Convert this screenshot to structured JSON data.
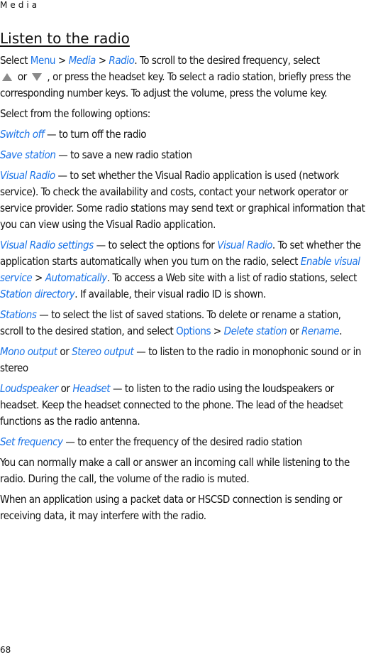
{
  "header": {
    "section": "Media"
  },
  "title": "Listen to the radio",
  "intro": {
    "t1": "Select ",
    "menu": "Menu",
    "sep1": " > ",
    "media": "Media",
    "sep2": " > ",
    "radio": "Radio",
    "t2": ". To scroll to the desired frequency, select ",
    "up_icon": "up-arrow-icon",
    "t3": " or ",
    "down_icon": "down-arrow-icon",
    "t4": " , or press the headset key. To select a radio station, briefly press the corresponding number keys. To adjust the volume, press the volume key."
  },
  "options_intro": "Select from the following options:",
  "options": {
    "switch_off": {
      "label": "Switch off",
      "desc": " — to turn off the radio"
    },
    "save_station": {
      "label": "Save station",
      "desc": " — to save a new radio station"
    },
    "visual_radio": {
      "label": "Visual Radio",
      "desc": " — to set whether the Visual Radio application is used (network service). To check the availability and costs, contact your network operator or service provider. Some radio stations may send text or graphical information that you can view using the Visual Radio application."
    },
    "visual_radio_settings": {
      "label": "Visual Radio settings",
      "d1": " — to select the options for ",
      "l1": "Visual Radio",
      "d2": ". To set whether the application starts automatically when you turn on the radio, select ",
      "l2": "Enable visual service",
      "d3": " > ",
      "l3": "Automatically",
      "d4": ". To access a Web site with a list of radio stations, select ",
      "l4": "Station directory",
      "d5": ". If available, their visual radio ID is shown."
    },
    "stations": {
      "label": "Stations",
      "d1": " — to select the list of saved stations. To delete or rename a station, scroll to the desired station, and select ",
      "l1": "Options",
      "d2": " > ",
      "l2": "Delete station",
      "d3": " or ",
      "l3": "Rename",
      "d4": "."
    },
    "output": {
      "label1": "Mono output",
      "or": " or ",
      "label2": "Stereo output",
      "desc": " — to listen to the radio in monophonic sound or in stereo"
    },
    "speaker": {
      "label1": "Loudspeaker",
      "or": " or ",
      "label2": "Headset",
      "desc": " — to listen to the radio using the loudspeakers or headset. Keep the headset connected to the phone. The lead of the headset functions as the radio antenna."
    },
    "set_frequency": {
      "label": "Set frequency",
      "desc": " — to enter the frequency of the desired radio station"
    }
  },
  "para_call": "You can normally make a call or answer an incoming call while listening to the radio. During the call, the volume of the radio is muted.",
  "para_data": "When an application using a packet data or HSCSD connection is sending or receiving data, it may interfere with the radio.",
  "page_number": "68",
  "colors": {
    "link": "#1a73e8",
    "text": "#111111",
    "icon": "#8a8a8a"
  }
}
